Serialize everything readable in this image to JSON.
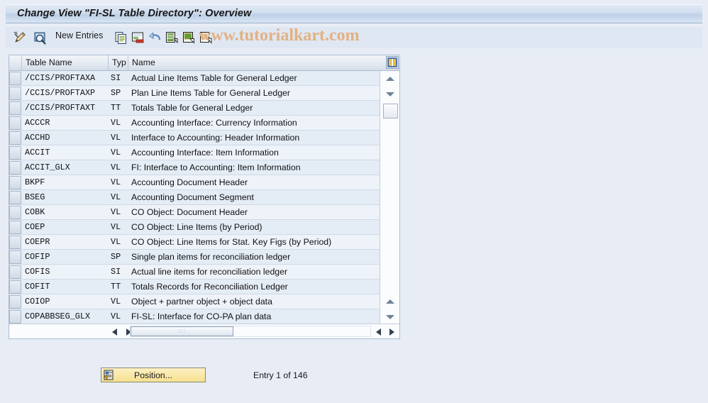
{
  "window": {
    "title": "Change View \"FI-SL Table Directory\": Overview"
  },
  "toolbar": {
    "items": [
      {
        "name": "display-change-icon",
        "label": "",
        "icon": "pencil-toggle-icon"
      },
      {
        "name": "details-icon",
        "label": "",
        "icon": "magnifier-document-icon"
      },
      {
        "name": "new-entries-button",
        "label": "New Entries",
        "icon": ""
      },
      {
        "name": "copy-icon",
        "label": "",
        "icon": "copy-icon"
      },
      {
        "name": "delete-icon",
        "label": "",
        "icon": "delete-row-icon"
      },
      {
        "name": "undo-icon",
        "label": "",
        "icon": "undo-arrow-icon"
      },
      {
        "name": "select-all-icon",
        "label": "",
        "icon": "select-all-icon"
      },
      {
        "name": "deselect-all-icon",
        "label": "",
        "icon": "deselect-all-icon"
      },
      {
        "name": "select-block-icon",
        "label": "",
        "icon": "select-block-icon"
      }
    ],
    "new_entries_label": "New Entries"
  },
  "watermark": {
    "text": "www.tutorialkart.com",
    "color": "#e2b184"
  },
  "table": {
    "columns": [
      {
        "key": "select",
        "label": ""
      },
      {
        "key": "table_name",
        "label": "Table Name"
      },
      {
        "key": "typ",
        "label": "Typ"
      },
      {
        "key": "name",
        "label": "Name"
      }
    ],
    "rows": [
      {
        "table_name": "/CCIS/PROFTAXA",
        "typ": "SI",
        "name": "Actual Line Items Table for General Ledger"
      },
      {
        "table_name": "/CCIS/PROFTAXP",
        "typ": "SP",
        "name": "Plan Line Items Table for General Ledger"
      },
      {
        "table_name": "/CCIS/PROFTAXT",
        "typ": "TT",
        "name": "Totals Table for General Ledger"
      },
      {
        "table_name": "ACCCR",
        "typ": "VL",
        "name": "Accounting Interface: Currency Information"
      },
      {
        "table_name": "ACCHD",
        "typ": "VL",
        "name": "Interface to Accounting: Header Information"
      },
      {
        "table_name": "ACCIT",
        "typ": "VL",
        "name": "Accounting Interface: Item Information"
      },
      {
        "table_name": "ACCIT_GLX",
        "typ": "VL",
        "name": "FI: Interface to Accounting: Item Information"
      },
      {
        "table_name": "BKPF",
        "typ": "VL",
        "name": "Accounting Document Header"
      },
      {
        "table_name": "BSEG",
        "typ": "VL",
        "name": "Accounting Document Segment"
      },
      {
        "table_name": "COBK",
        "typ": "VL",
        "name": "CO Object: Document Header"
      },
      {
        "table_name": "COEP",
        "typ": "VL",
        "name": "CO Object: Line Items (by Period)"
      },
      {
        "table_name": "COEPR",
        "typ": "VL",
        "name": "CO Object: Line Items for Stat. Key Figs (by Period)"
      },
      {
        "table_name": "COFIP",
        "typ": "SP",
        "name": "Single plan items for reconciliation ledger"
      },
      {
        "table_name": "COFIS",
        "typ": "SI",
        "name": "Actual line items for reconciliation ledger"
      },
      {
        "table_name": "COFIT",
        "typ": "TT",
        "name": "Totals Records for Reconciliation Ledger"
      },
      {
        "table_name": "COIOP",
        "typ": "VL",
        "name": "Object + partner object + object data"
      },
      {
        "table_name": "COPABBSEG_GLX",
        "typ": "VL",
        "name": "FI-SL: Interface for CO-PA plan data"
      }
    ]
  },
  "footer": {
    "position_button_label": "Position...",
    "entry_status": "Entry 1 of 146"
  }
}
